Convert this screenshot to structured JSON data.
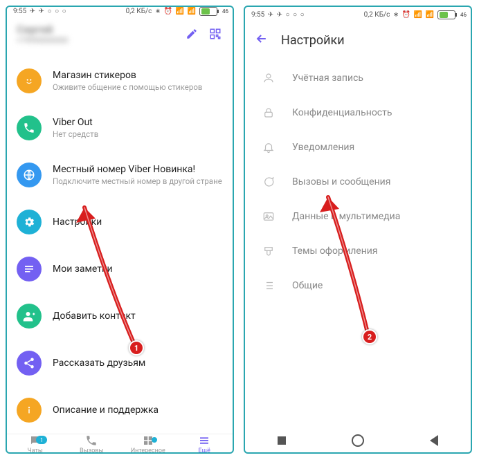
{
  "status": {
    "time": "9:55",
    "data": "0,2 КБ/с",
    "battery": "46"
  },
  "screen1": {
    "profile_name": "Сергей",
    "profile_sub": "+79990000000",
    "items": {
      "stickers": {
        "title": "Магазин стикеров",
        "sub": "Оживите общение с помощью стикеров"
      },
      "viberout": {
        "title": "Viber Out",
        "sub": "Нет средств"
      },
      "localnum": {
        "title_prefix": "Местный номер Viber ",
        "novinka": "Новинка!",
        "sub": "Подключите местный номер в другой стране"
      },
      "settings": {
        "title": "Настройки"
      },
      "notes": {
        "title": "Мои заметки"
      },
      "addcontact": {
        "title": "Добавить контакт"
      },
      "share": {
        "title": "Рассказать друзьям"
      },
      "info": {
        "title": "Описание и поддержка"
      }
    },
    "nav": {
      "chats": "Чаты",
      "calls": "Вызовы",
      "explore": "Интересное",
      "more": "Ещё",
      "chats_badge": "1"
    },
    "marker": "1"
  },
  "screen2": {
    "title": "Настройки",
    "rows": {
      "account": "Учётная запись",
      "privacy": "Конфиденциальность",
      "notifications": "Уведомления",
      "calls": "Вызовы и сообщения",
      "media": "Данные и мультимедиа",
      "themes": "Темы оформления",
      "general": "Общие"
    },
    "marker": "2"
  }
}
